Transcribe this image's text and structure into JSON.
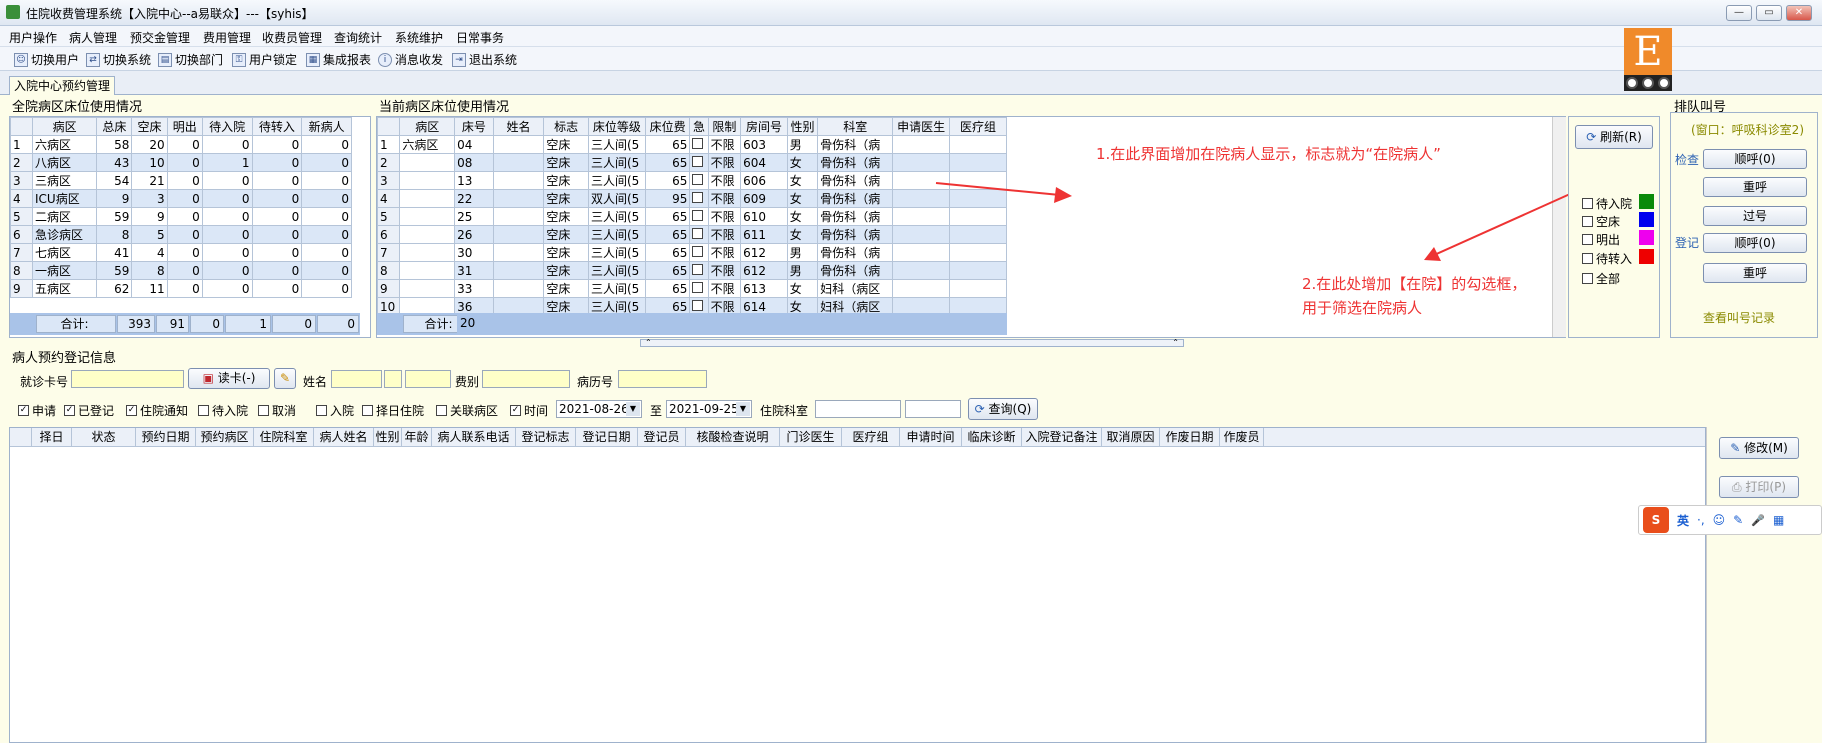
{
  "window": {
    "title": "住院收费管理系统【入院中心--a易联众】---【syhis】",
    "min": "—",
    "max": "▭",
    "close": "✕"
  },
  "menu": [
    "用户操作",
    "病人管理",
    "预交金管理",
    "费用管理",
    "收费员管理",
    "查询统计",
    "系统维护",
    "日常事务"
  ],
  "toolbar": [
    {
      "label": "切换用户",
      "icon": "users-icon"
    },
    {
      "label": "切换系统",
      "icon": "switch-system-icon"
    },
    {
      "label": "切换部门",
      "icon": "department-icon"
    },
    {
      "label": "用户锁定",
      "icon": "lock-user-icon"
    },
    {
      "label": "集成报表",
      "icon": "report-icon"
    },
    {
      "label": "消息收发",
      "icon": "info-icon"
    },
    {
      "label": "退出系统",
      "icon": "exit-icon"
    }
  ],
  "tab": "入院中心预约管理",
  "logo_letter": "E",
  "ward_panel": {
    "title": "全院病区床位使用情况",
    "headers": [
      "病区",
      "总床",
      "空床",
      "明出",
      "待入院",
      "待转入",
      "新病人"
    ],
    "rows": [
      [
        "1",
        "六病区",
        "58",
        "20",
        "0",
        "0",
        "0",
        "0"
      ],
      [
        "2",
        "八病区",
        "43",
        "10",
        "0",
        "1",
        "0",
        "0"
      ],
      [
        "3",
        "三病区",
        "54",
        "21",
        "0",
        "0",
        "0",
        "0"
      ],
      [
        "4",
        "ICU病区",
        "9",
        "3",
        "0",
        "0",
        "0",
        "0"
      ],
      [
        "5",
        "二病区",
        "59",
        "9",
        "0",
        "0",
        "0",
        "0"
      ],
      [
        "6",
        "急诊病区",
        "8",
        "5",
        "0",
        "0",
        "0",
        "0"
      ],
      [
        "7",
        "七病区",
        "41",
        "4",
        "0",
        "0",
        "0",
        "0"
      ],
      [
        "8",
        "一病区",
        "59",
        "8",
        "0",
        "0",
        "0",
        "0"
      ],
      [
        "9",
        "五病区",
        "62",
        "11",
        "0",
        "0",
        "0",
        "0"
      ]
    ],
    "total_label": "合计:",
    "totals": [
      "393",
      "91",
      "0",
      "1",
      "0",
      "0"
    ]
  },
  "bed_panel": {
    "title": "当前病区床位使用情况",
    "headers": [
      "病区",
      "床号",
      "姓名",
      "标志",
      "床位等级",
      "床位费",
      "急",
      "限制",
      "房间号",
      "性别",
      "科室",
      "申请医生",
      "医疗组"
    ],
    "ward": "六病区",
    "rows": [
      [
        "1",
        "04",
        "",
        "空床",
        "三人间(5",
        "65",
        "不限",
        "603",
        "男",
        "骨伤科（病"
      ],
      [
        "2",
        "08",
        "",
        "空床",
        "三人间(5",
        "65",
        "不限",
        "604",
        "女",
        "骨伤科（病"
      ],
      [
        "3",
        "13",
        "",
        "空床",
        "三人间(5",
        "65",
        "不限",
        "606",
        "女",
        "骨伤科（病"
      ],
      [
        "4",
        "22",
        "",
        "空床",
        "双人间(5",
        "95",
        "不限",
        "609",
        "女",
        "骨伤科（病"
      ],
      [
        "5",
        "25",
        "",
        "空床",
        "三人间(5",
        "65",
        "不限",
        "610",
        "女",
        "骨伤科（病"
      ],
      [
        "6",
        "26",
        "",
        "空床",
        "三人间(5",
        "65",
        "不限",
        "611",
        "女",
        "骨伤科（病"
      ],
      [
        "7",
        "30",
        "",
        "空床",
        "三人间(5",
        "65",
        "不限",
        "612",
        "男",
        "骨伤科（病"
      ],
      [
        "8",
        "31",
        "",
        "空床",
        "三人间(5",
        "65",
        "不限",
        "612",
        "男",
        "骨伤科（病"
      ],
      [
        "9",
        "33",
        "",
        "空床",
        "三人间(5",
        "65",
        "不限",
        "613",
        "女",
        "妇科（病区"
      ],
      [
        "10",
        "36",
        "",
        "空床",
        "三人间(5",
        "65",
        "不限",
        "614",
        "女",
        "妇科（病区"
      ]
    ],
    "total_label": "合计:",
    "total": "20"
  },
  "annotations": {
    "a1": "1.在此界面增加在院病人显示，标志就为“在院病人”",
    "a2_line1": "2.在此处增加【在院】的勾选框，",
    "a2_line2": "用于筛选在院病人"
  },
  "side": {
    "refresh": "刷新(R)",
    "filters": [
      {
        "label": "待入院",
        "color": "#0a8a0a"
      },
      {
        "label": "空床",
        "color": "#0000ee"
      },
      {
        "label": "明出",
        "color": "#ee00ee"
      },
      {
        "label": "待转入",
        "color": "#ee0000"
      },
      {
        "label": "全部",
        "color": ""
      }
    ]
  },
  "queue": {
    "title": "排队叫号",
    "window_label": "(窗口：呼吸科诊室2)",
    "check_label": "检查",
    "register_label": "登记",
    "btn_call1": "顺呼(0)",
    "btn_recall1": "重呼",
    "btn_skip": "过号",
    "btn_call2": "顺呼(0)",
    "btn_recall2": "重呼",
    "view_records": "查看叫号记录"
  },
  "reg": {
    "title": "病人预约登记信息",
    "card_label": "就诊卡号",
    "read_card": "读卡(-)",
    "name_label": "姓名",
    "fee_label": "费别",
    "record_label": "病历号",
    "checks": [
      {
        "label": "申请",
        "checked": true
      },
      {
        "label": "已登记",
        "checked": true
      },
      {
        "label": "住院通知",
        "checked": true
      },
      {
        "label": "待入院",
        "checked": false
      },
      {
        "label": "取消",
        "checked": false
      },
      {
        "label": "入院",
        "checked": false
      },
      {
        "label": "择日住院",
        "checked": false
      },
      {
        "label": "关联病区",
        "checked": false
      },
      {
        "label": "时间",
        "checked": true
      }
    ],
    "date_from": "2021-08-26",
    "to_label": "至",
    "date_to": "2021-09-25",
    "dept_label": "住院科室",
    "query": "查询(Q)",
    "modify": "修改(M)",
    "print": "打印(P)",
    "list_headers": [
      "择日",
      "状态",
      "预约日期",
      "预约病区",
      "住院科室",
      "病人姓名",
      "性别",
      "年龄",
      "病人联系电话",
      "登记标志",
      "登记日期",
      "登记员",
      "核酸检查说明",
      "门诊医生",
      "医疗组",
      "申请时间",
      "临床诊断",
      "入院登记备注",
      "取消原因",
      "作废日期",
      "作废员"
    ]
  },
  "ime": {
    "lang": "英",
    "items": [
      "·,",
      "☺",
      "✎",
      "🎤",
      "▦"
    ]
  }
}
